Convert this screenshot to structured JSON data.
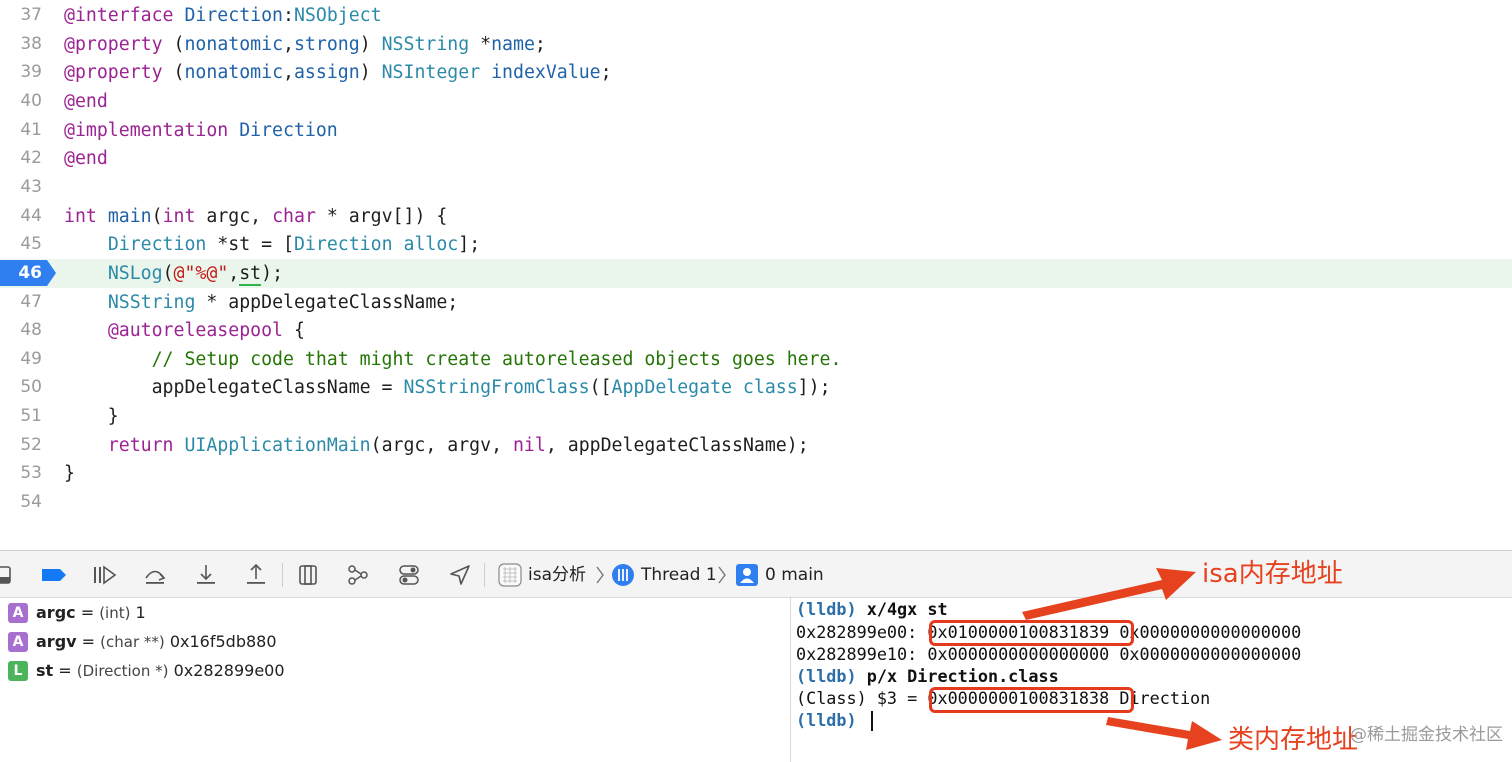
{
  "editor": {
    "lines": [
      {
        "num": "37",
        "tokens": [
          {
            "t": "@interface",
            "c": "kw"
          },
          {
            "t": " ",
            "c": "pl"
          },
          {
            "t": "Direction",
            "c": "prop"
          },
          {
            "t": ":",
            "c": "pl"
          },
          {
            "t": "NSObject",
            "c": "ty"
          }
        ]
      },
      {
        "num": "38",
        "tokens": [
          {
            "t": "@property",
            "c": "kw"
          },
          {
            "t": " (",
            "c": "pl"
          },
          {
            "t": "nonatomic",
            "c": "prop"
          },
          {
            "t": ",",
            "c": "pl"
          },
          {
            "t": "strong",
            "c": "prop"
          },
          {
            "t": ") ",
            "c": "pl"
          },
          {
            "t": "NSString",
            "c": "ty"
          },
          {
            "t": " *",
            "c": "pl"
          },
          {
            "t": "name",
            "c": "prop"
          },
          {
            "t": ";",
            "c": "pl"
          }
        ]
      },
      {
        "num": "39",
        "tokens": [
          {
            "t": "@property",
            "c": "kw"
          },
          {
            "t": " (",
            "c": "pl"
          },
          {
            "t": "nonatomic",
            "c": "prop"
          },
          {
            "t": ",",
            "c": "pl"
          },
          {
            "t": "assign",
            "c": "prop"
          },
          {
            "t": ") ",
            "c": "pl"
          },
          {
            "t": "NSInteger",
            "c": "ty"
          },
          {
            "t": " ",
            "c": "pl"
          },
          {
            "t": "indexValue",
            "c": "prop"
          },
          {
            "t": ";",
            "c": "pl"
          }
        ]
      },
      {
        "num": "40",
        "tokens": [
          {
            "t": "@end",
            "c": "kw"
          }
        ]
      },
      {
        "num": "41",
        "tokens": [
          {
            "t": "@implementation",
            "c": "kw"
          },
          {
            "t": " ",
            "c": "pl"
          },
          {
            "t": "Direction",
            "c": "prop"
          }
        ]
      },
      {
        "num": "42",
        "tokens": [
          {
            "t": "@end",
            "c": "kw"
          }
        ]
      },
      {
        "num": "43",
        "tokens": []
      },
      {
        "num": "44",
        "tokens": [
          {
            "t": "int",
            "c": "kw"
          },
          {
            "t": " ",
            "c": "pl"
          },
          {
            "t": "main",
            "c": "prop"
          },
          {
            "t": "(",
            "c": "pl"
          },
          {
            "t": "int",
            "c": "kw"
          },
          {
            "t": " argc, ",
            "c": "pl"
          },
          {
            "t": "char",
            "c": "kw"
          },
          {
            "t": " * argv[]) {",
            "c": "pl"
          }
        ]
      },
      {
        "num": "45",
        "tokens": [
          {
            "t": "    ",
            "c": "pl"
          },
          {
            "t": "Direction",
            "c": "ty"
          },
          {
            "t": " *st = [",
            "c": "pl"
          },
          {
            "t": "Direction",
            "c": "ty"
          },
          {
            "t": " ",
            "c": "pl"
          },
          {
            "t": "alloc",
            "c": "ty"
          },
          {
            "t": "];",
            "c": "pl"
          }
        ]
      },
      {
        "num": "46",
        "current": true,
        "tokens": [
          {
            "t": "    ",
            "c": "pl"
          },
          {
            "t": "NSLog",
            "c": "ty"
          },
          {
            "t": "(",
            "c": "pl"
          },
          {
            "t": "@\"%@\"",
            "c": "str"
          },
          {
            "t": ",",
            "c": "pl"
          },
          {
            "t": "st",
            "c": "pl st-under"
          },
          {
            "t": ");",
            "c": "pl"
          }
        ]
      },
      {
        "num": "47",
        "tokens": [
          {
            "t": "    ",
            "c": "pl"
          },
          {
            "t": "NSString",
            "c": "ty"
          },
          {
            "t": " * appDelegateClassName;",
            "c": "pl"
          }
        ]
      },
      {
        "num": "48",
        "tokens": [
          {
            "t": "    ",
            "c": "pl"
          },
          {
            "t": "@autoreleasepool",
            "c": "kw"
          },
          {
            "t": " {",
            "c": "pl"
          }
        ]
      },
      {
        "num": "49",
        "tokens": [
          {
            "t": "        ",
            "c": "pl"
          },
          {
            "t": "// Setup code that might create autoreleased objects goes here.",
            "c": "com"
          }
        ]
      },
      {
        "num": "50",
        "tokens": [
          {
            "t": "        appDelegateClassName = ",
            "c": "pl"
          },
          {
            "t": "NSStringFromClass",
            "c": "ty"
          },
          {
            "t": "([",
            "c": "pl"
          },
          {
            "t": "AppDelegate",
            "c": "ty"
          },
          {
            "t": " ",
            "c": "pl"
          },
          {
            "t": "class",
            "c": "ty"
          },
          {
            "t": "]);",
            "c": "pl"
          }
        ]
      },
      {
        "num": "51",
        "tokens": [
          {
            "t": "    }",
            "c": "pl"
          }
        ]
      },
      {
        "num": "52",
        "tokens": [
          {
            "t": "    ",
            "c": "pl"
          },
          {
            "t": "return",
            "c": "kw"
          },
          {
            "t": " ",
            "c": "pl"
          },
          {
            "t": "UIApplicationMain",
            "c": "ty"
          },
          {
            "t": "(argc, argv, ",
            "c": "pl"
          },
          {
            "t": "nil",
            "c": "kw"
          },
          {
            "t": ", appDelegateClassName);",
            "c": "pl"
          }
        ]
      },
      {
        "num": "53",
        "tokens": [
          {
            "t": "}",
            "c": "pl"
          }
        ]
      },
      {
        "num": "54",
        "tokens": []
      }
    ]
  },
  "debugbar": {
    "breadcrumb": {
      "target": "isa分析",
      "thread": "Thread 1",
      "frame": "0 main"
    }
  },
  "variables": [
    {
      "badge": "A",
      "name": "argc",
      "type": "(int)",
      "value": "1"
    },
    {
      "badge": "A",
      "name": "argv",
      "type": "(char **)",
      "value": "0x16f5db880"
    },
    {
      "badge": "L",
      "name": "st",
      "type": "(Direction *)",
      "value": "0x282899e00"
    }
  ],
  "console": {
    "prompt": "(lldb)",
    "cmd1": "x/4gx st",
    "addr1": "0x282899e00:",
    "isa_value": "0x0100000100831839",
    "val1b": "0x0000000000000000",
    "addr2": "0x282899e10:",
    "val2a": "0x0000000000000000",
    "val2b": "0x0000000000000000",
    "cmd2": "p/x Direction.class",
    "result_prefix": "(Class) $3 =",
    "class_value": "0x0000000100831838",
    "class_name": "Direction"
  },
  "annotations": {
    "isa_label": "isa内存地址",
    "class_label": "类内存地址",
    "watermark": "@稀土掘金技术社区",
    "color": "#e6421f"
  }
}
